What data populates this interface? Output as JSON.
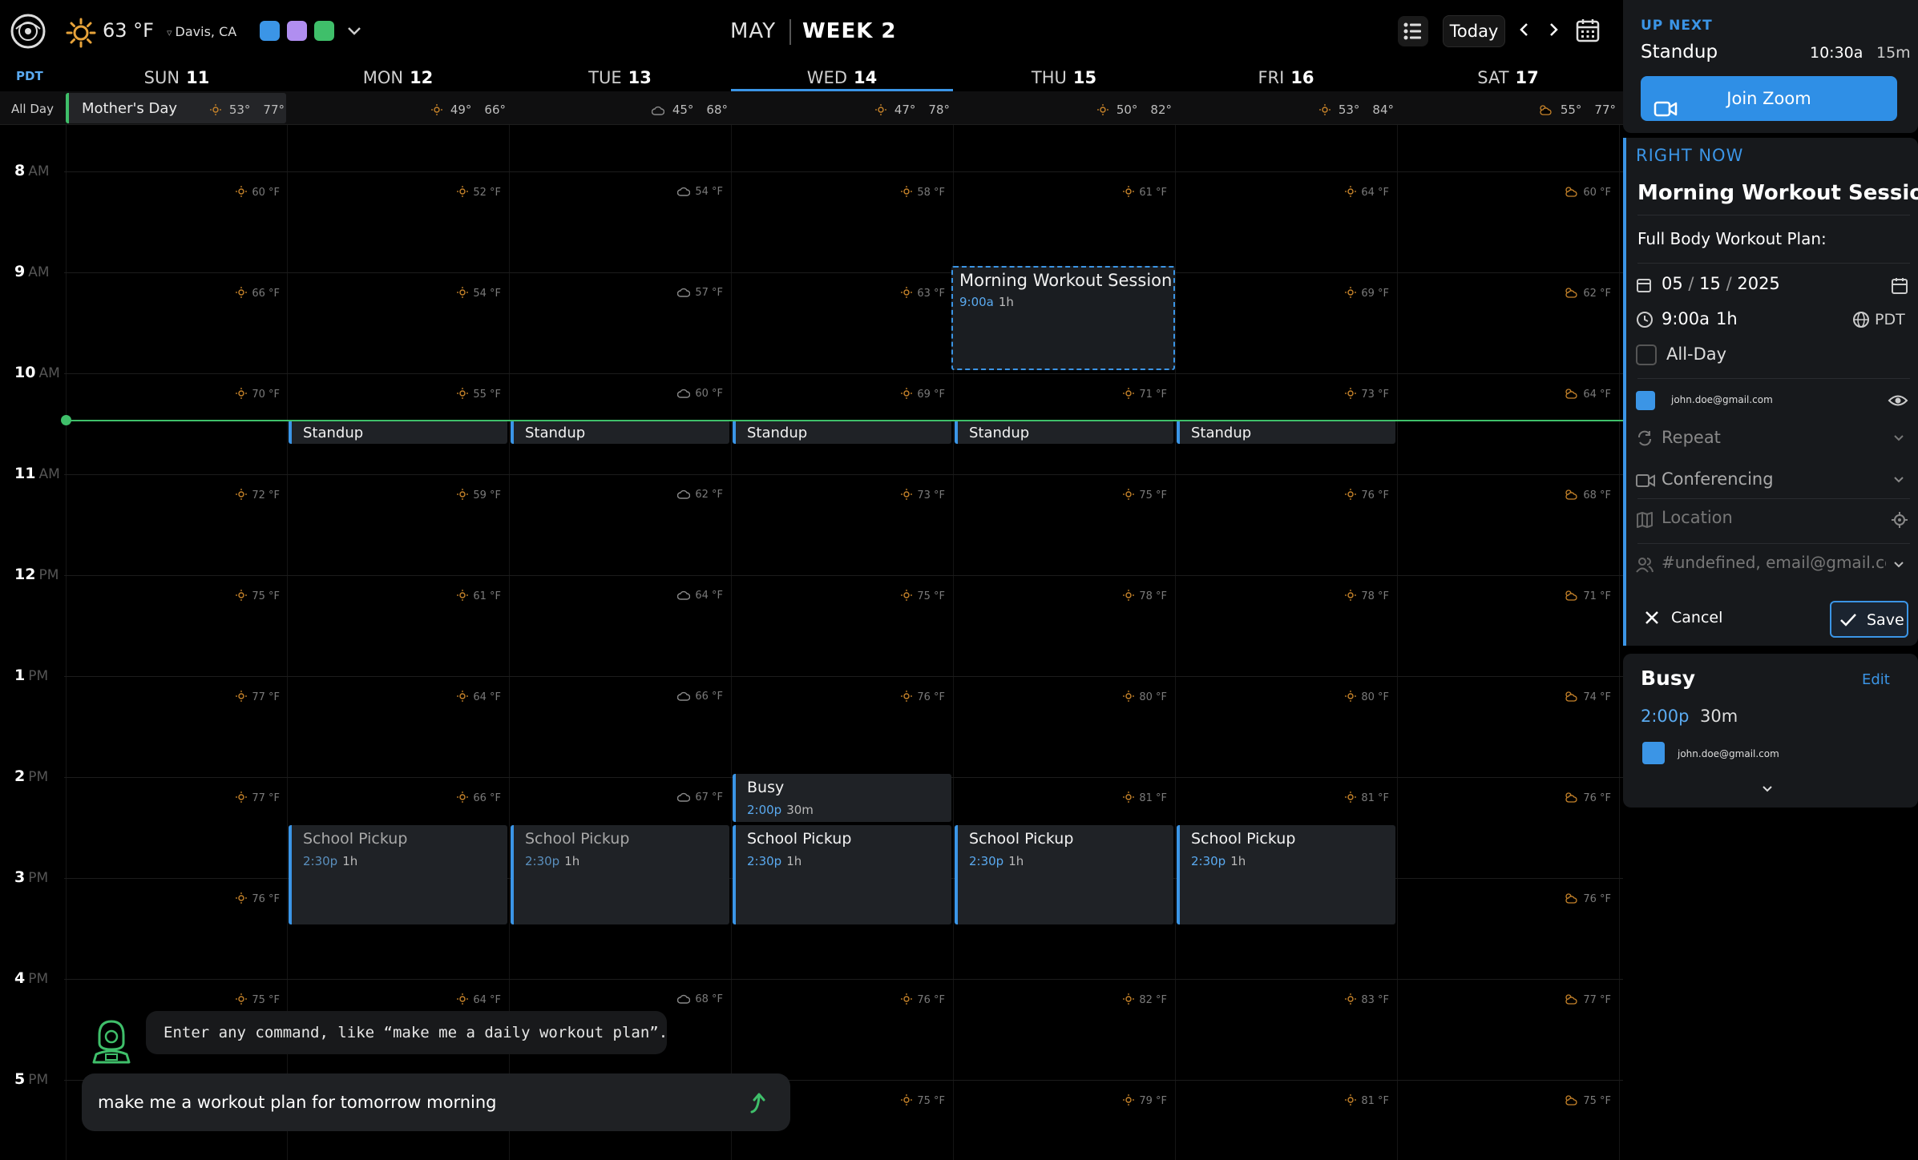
{
  "header": {
    "weather_temp": "63 °F",
    "location": "Davis, CA",
    "month": "MAY",
    "week": "WEEK 2",
    "today_label": "Today",
    "timezone": "PDT",
    "calendar_colors": [
      "#3b95e6",
      "#b08ef0",
      "#3fbf6a"
    ]
  },
  "days": [
    {
      "name": "SUN",
      "num": "11",
      "lo": "53°",
      "hi": "77°",
      "icon": "sun-icon"
    },
    {
      "name": "MON",
      "num": "12",
      "lo": "49°",
      "hi": "66°",
      "icon": "sun-icon"
    },
    {
      "name": "TUE",
      "num": "13",
      "lo": "45°",
      "hi": "68°",
      "icon": "cloud-icon"
    },
    {
      "name": "WED",
      "num": "14",
      "lo": "47°",
      "hi": "78°",
      "icon": "sun-icon"
    },
    {
      "name": "THU",
      "num": "15",
      "lo": "50°",
      "hi": "82°",
      "icon": "sun-icon"
    },
    {
      "name": "FRI",
      "num": "16",
      "lo": "53°",
      "hi": "84°",
      "icon": "sun-icon"
    },
    {
      "name": "SAT",
      "num": "17",
      "lo": "55°",
      "hi": "77°",
      "icon": "partly-cloudy-icon"
    }
  ],
  "all_day": {
    "label": "All Day",
    "event": "Mother's Day"
  },
  "hours": [
    {
      "h": "8",
      "ampm": "AM"
    },
    {
      "h": "9",
      "ampm": "AM"
    },
    {
      "h": "10",
      "ampm": "AM"
    },
    {
      "h": "11",
      "ampm": "AM"
    },
    {
      "h": "12",
      "ampm": "PM"
    },
    {
      "h": "1",
      "ampm": "PM"
    },
    {
      "h": "2",
      "ampm": "PM"
    },
    {
      "h": "3",
      "ampm": "PM"
    },
    {
      "h": "4",
      "ampm": "PM"
    },
    {
      "h": "5",
      "ampm": "PM"
    }
  ],
  "hourly_temps": [
    [
      "60 °F",
      "52 °F",
      "54 °F",
      "58 °F",
      "61 °F",
      "64 °F",
      "60 °F"
    ],
    [
      "66 °F",
      "54 °F",
      "57 °F",
      "63 °F",
      "",
      "69 °F",
      "62 °F"
    ],
    [
      "70 °F",
      "55 °F",
      "60 °F",
      "69 °F",
      "71 °F",
      "73 °F",
      "64 °F"
    ],
    [
      "72 °F",
      "59 °F",
      "62 °F",
      "73 °F",
      "75 °F",
      "76 °F",
      "68 °F"
    ],
    [
      "75 °F",
      "61 °F",
      "64 °F",
      "75 °F",
      "78 °F",
      "78 °F",
      "71 °F"
    ],
    [
      "77 °F",
      "64 °F",
      "66 °F",
      "76 °F",
      "80 °F",
      "80 °F",
      "74 °F"
    ],
    [
      "77 °F",
      "66 °F",
      "67 °F",
      "",
      "81 °F",
      "81 °F",
      "76 °F"
    ],
    [
      "76 °F",
      "",
      "",
      "",
      "",
      "",
      "76 °F"
    ],
    [
      "75 °F",
      "64 °F",
      "68 °F",
      "76 °F",
      "82 °F",
      "83 °F",
      "77 °F"
    ],
    [
      "",
      "",
      "",
      "75 °F",
      "79 °F",
      "81 °F",
      "75 °F"
    ]
  ],
  "events": {
    "standup_title": "Standup",
    "pickup_title": "School Pickup",
    "pickup_time": "2:30p",
    "pickup_dur": "1h",
    "busy_title": "Busy",
    "busy_time": "2:00p",
    "busy_dur": "30m",
    "workout_title": "Morning Workout Session",
    "workout_time": "9:00a",
    "workout_dur": "1h"
  },
  "up_next": {
    "label": "UP NEXT",
    "title": "Standup",
    "time": "10:30a",
    "duration": "15m",
    "join_label": "Join Zoom"
  },
  "right_now": {
    "label": "RIGHT NOW",
    "title": "Morning Workout Session",
    "description": "Full Body Workout Plan:",
    "date_m": "05",
    "date_d": "15",
    "date_y": "2025",
    "time": "9:00a",
    "duration": "1h",
    "tz": "PDT",
    "all_day_label": "All-Day",
    "calendar_email": "john.doe@gmail.com",
    "repeat_label": "Repeat",
    "conferencing_label": "Conferencing",
    "location_placeholder": "Location",
    "attendees": "#undefined, email@gmail.com",
    "cancel_label": "Cancel",
    "save_label": "Save"
  },
  "busy_card": {
    "title": "Busy",
    "edit_label": "Edit",
    "time": "2:00p",
    "duration": "30m",
    "email": "john.doe@gmail.com"
  },
  "command": {
    "hint": "Enter any command, like “make me a daily workout plan”.",
    "input_value": "make me a workout plan for tomorrow morning"
  }
}
